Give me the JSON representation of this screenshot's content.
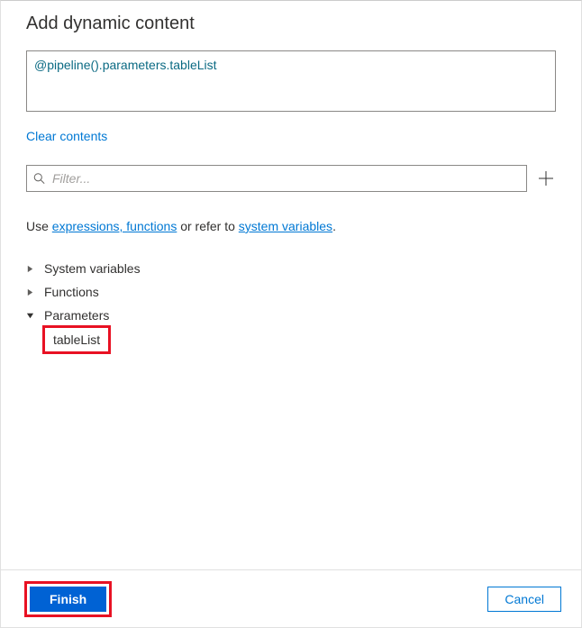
{
  "header": {
    "title": "Add dynamic content"
  },
  "editor": {
    "expression": "@pipeline().parameters.tableList",
    "clear_label": "Clear contents"
  },
  "filter": {
    "placeholder": "Filter..."
  },
  "hint": {
    "prefix": "Use ",
    "link1": "expressions, functions",
    "middle": " or refer to ",
    "link2": "system variables",
    "suffix": "."
  },
  "tree": {
    "items": [
      {
        "label": "System variables",
        "expanded": false
      },
      {
        "label": "Functions",
        "expanded": false
      },
      {
        "label": "Parameters",
        "expanded": true
      }
    ],
    "parameters": [
      {
        "name": "tableList"
      }
    ]
  },
  "footer": {
    "finish": "Finish",
    "cancel": "Cancel"
  }
}
